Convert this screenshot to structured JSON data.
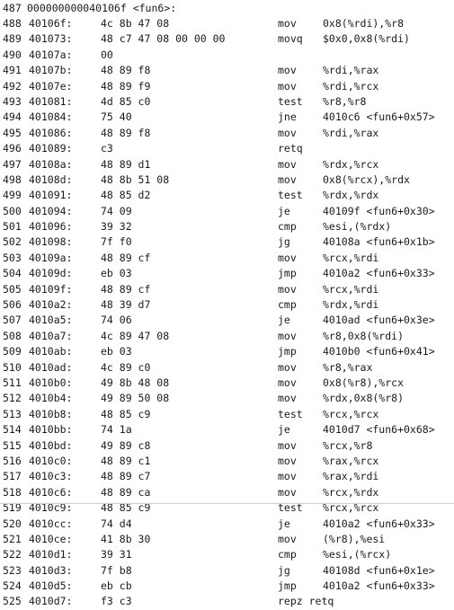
{
  "header": {
    "line_no": "487",
    "label": "000000000040106f <fun6>:"
  },
  "rows": [
    {
      "line": "488",
      "addr": "40106f:",
      "bytes": "4c 8b 47 08",
      "mnemonic": "mov",
      "operands": "0x8(%rdi),%r8"
    },
    {
      "line": "489",
      "addr": "401073:",
      "bytes": "48 c7 47 08 00 00 00",
      "mnemonic": "movq",
      "operands": "$0x0,0x8(%rdi)"
    },
    {
      "line": "490",
      "addr": "40107a:",
      "bytes": "00",
      "mnemonic": "",
      "operands": ""
    },
    {
      "line": "491",
      "addr": "40107b:",
      "bytes": "48 89 f8",
      "mnemonic": "mov",
      "operands": "%rdi,%rax"
    },
    {
      "line": "492",
      "addr": "40107e:",
      "bytes": "48 89 f9",
      "mnemonic": "mov",
      "operands": "%rdi,%rcx"
    },
    {
      "line": "493",
      "addr": "401081:",
      "bytes": "4d 85 c0",
      "mnemonic": "test",
      "operands": "%r8,%r8"
    },
    {
      "line": "494",
      "addr": "401084:",
      "bytes": "75 40",
      "mnemonic": "jne",
      "operands": "4010c6 <fun6+0x57>"
    },
    {
      "line": "495",
      "addr": "401086:",
      "bytes": "48 89 f8",
      "mnemonic": "mov",
      "operands": "%rdi,%rax"
    },
    {
      "line": "496",
      "addr": "401089:",
      "bytes": "c3",
      "mnemonic": "retq",
      "operands": ""
    },
    {
      "line": "497",
      "addr": "40108a:",
      "bytes": "48 89 d1",
      "mnemonic": "mov",
      "operands": "%rdx,%rcx"
    },
    {
      "line": "498",
      "addr": "40108d:",
      "bytes": "48 8b 51 08",
      "mnemonic": "mov",
      "operands": "0x8(%rcx),%rdx"
    },
    {
      "line": "499",
      "addr": "401091:",
      "bytes": "48 85 d2",
      "mnemonic": "test",
      "operands": "%rdx,%rdx"
    },
    {
      "line": "500",
      "addr": "401094:",
      "bytes": "74 09",
      "mnemonic": "je",
      "operands": "40109f <fun6+0x30>"
    },
    {
      "line": "501",
      "addr": "401096:",
      "bytes": "39 32",
      "mnemonic": "cmp",
      "operands": "%esi,(%rdx)"
    },
    {
      "line": "502",
      "addr": "401098:",
      "bytes": "7f f0",
      "mnemonic": "jg",
      "operands": "40108a <fun6+0x1b>"
    },
    {
      "line": "503",
      "addr": "40109a:",
      "bytes": "48 89 cf",
      "mnemonic": "mov",
      "operands": "%rcx,%rdi"
    },
    {
      "line": "504",
      "addr": "40109d:",
      "bytes": "eb 03",
      "mnemonic": "jmp",
      "operands": "4010a2 <fun6+0x33>"
    },
    {
      "line": "505",
      "addr": "40109f:",
      "bytes": "48 89 cf",
      "mnemonic": "mov",
      "operands": "%rcx,%rdi"
    },
    {
      "line": "506",
      "addr": "4010a2:",
      "bytes": "48 39 d7",
      "mnemonic": "cmp",
      "operands": "%rdx,%rdi"
    },
    {
      "line": "507",
      "addr": "4010a5:",
      "bytes": "74 06",
      "mnemonic": "je",
      "operands": "4010ad <fun6+0x3e>"
    },
    {
      "line": "508",
      "addr": "4010a7:",
      "bytes": "4c 89 47 08",
      "mnemonic": "mov",
      "operands": "%r8,0x8(%rdi)"
    },
    {
      "line": "509",
      "addr": "4010ab:",
      "bytes": "eb 03",
      "mnemonic": "jmp",
      "operands": "4010b0 <fun6+0x41>"
    },
    {
      "line": "510",
      "addr": "4010ad:",
      "bytes": "4c 89 c0",
      "mnemonic": "mov",
      "operands": "%r8,%rax"
    },
    {
      "line": "511",
      "addr": "4010b0:",
      "bytes": "49 8b 48 08",
      "mnemonic": "mov",
      "operands": "0x8(%r8),%rcx"
    },
    {
      "line": "512",
      "addr": "4010b4:",
      "bytes": "49 89 50 08",
      "mnemonic": "mov",
      "operands": "%rdx,0x8(%r8)"
    },
    {
      "line": "513",
      "addr": "4010b8:",
      "bytes": "48 85 c9",
      "mnemonic": "test",
      "operands": "%rcx,%rcx"
    },
    {
      "line": "514",
      "addr": "4010bb:",
      "bytes": "74 1a",
      "mnemonic": "je",
      "operands": "4010d7 <fun6+0x68>"
    },
    {
      "line": "515",
      "addr": "4010bd:",
      "bytes": "49 89 c8",
      "mnemonic": "mov",
      "operands": "%rcx,%r8"
    },
    {
      "line": "516",
      "addr": "4010c0:",
      "bytes": "48 89 c1",
      "mnemonic": "mov",
      "operands": "%rax,%rcx"
    },
    {
      "line": "517",
      "addr": "4010c3:",
      "bytes": "48 89 c7",
      "mnemonic": "mov",
      "operands": "%rax,%rdi"
    },
    {
      "line": "518",
      "addr": "4010c6:",
      "bytes": "48 89 ca",
      "mnemonic": "mov",
      "operands": "%rcx,%rdx"
    },
    {
      "line": "519",
      "addr": "4010c9:",
      "bytes": "48 85 c9",
      "mnemonic": "test",
      "operands": "%rcx,%rcx"
    },
    {
      "line": "520",
      "addr": "4010cc:",
      "bytes": "74 d4",
      "mnemonic": "je",
      "operands": "4010a2 <fun6+0x33>"
    },
    {
      "line": "521",
      "addr": "4010ce:",
      "bytes": "41 8b 30",
      "mnemonic": "mov",
      "operands": "(%r8),%esi"
    },
    {
      "line": "522",
      "addr": "4010d1:",
      "bytes": "39 31",
      "mnemonic": "cmp",
      "operands": "%esi,(%rcx)"
    },
    {
      "line": "523",
      "addr": "4010d3:",
      "bytes": "7f b8",
      "mnemonic": "jg",
      "operands": "40108d <fun6+0x1e>"
    },
    {
      "line": "524",
      "addr": "4010d5:",
      "bytes": "eb cb",
      "mnemonic": "jmp",
      "operands": "4010a2 <fun6+0x33>"
    },
    {
      "line": "525",
      "addr": "4010d7:",
      "bytes": "f3 c3",
      "mnemonic": "repz retq",
      "operands": ""
    }
  ]
}
